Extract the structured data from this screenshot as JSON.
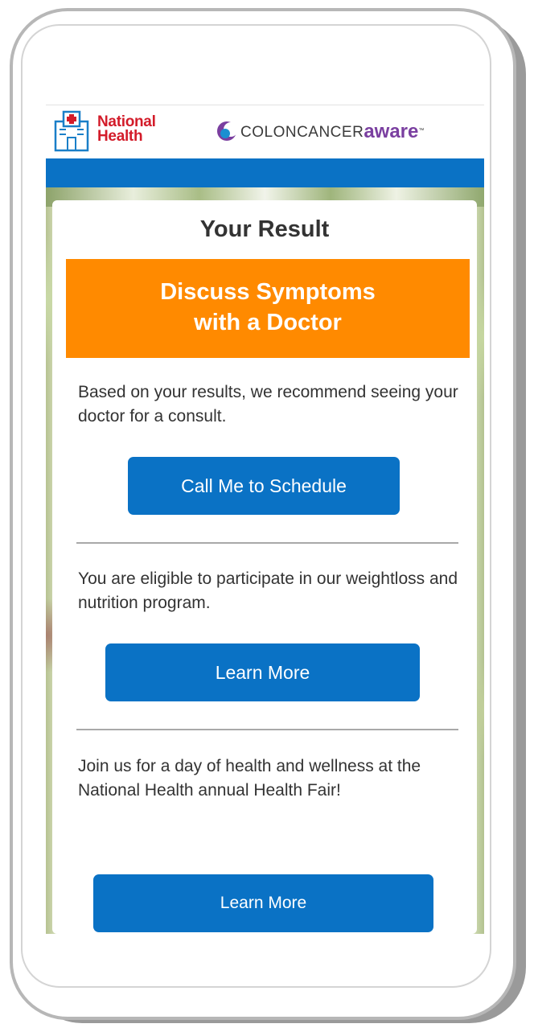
{
  "header": {
    "national_health_line1": "National",
    "national_health_line2": "Health",
    "cca_prefix": "COLONCANCER",
    "cca_suffix": "aware",
    "cca_tm": "™"
  },
  "result": {
    "title": "Your Result",
    "banner_line1": "Discuss Symptoms",
    "banner_line2": "with a Doctor"
  },
  "sections": [
    {
      "text": "Based on your results, we recommend seeing your doctor for a consult.",
      "button_label": "Call Me to Schedule"
    },
    {
      "text": "You are eligible to participate in our weightloss and nutrition program.",
      "button_label": "Learn More"
    },
    {
      "text": "Join us for a day of health and wellness at the National Health annual Health Fair!",
      "button_label": "Learn More"
    }
  ],
  "colors": {
    "brand_blue": "#0a72c5",
    "banner_orange": "#ff8a00",
    "national_health_red": "#d31c2a",
    "aware_purple": "#7a3fa0"
  }
}
